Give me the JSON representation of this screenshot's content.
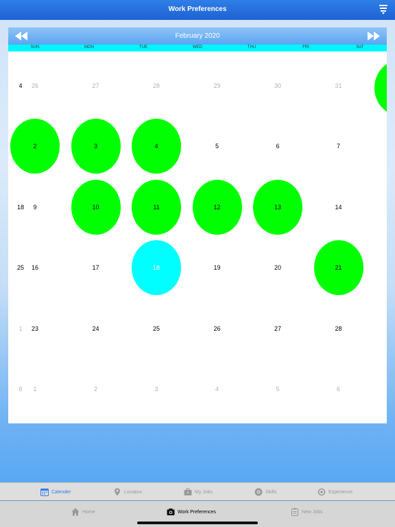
{
  "nav": {
    "title": "Work Preferences",
    "menu_icon": "filter-list-icon"
  },
  "calendar": {
    "month_title": "February 2020",
    "prev_icon": "double-left-arrow-icon",
    "next_icon": "double-right-arrow-icon",
    "weekdays": [
      "SUN",
      "MON",
      "TUE",
      "WED",
      "THU",
      "FRI",
      "SAT"
    ],
    "week_numbers": [
      {
        "text": "4",
        "muted": false
      },
      {
        "text": "",
        "muted": false
      },
      {
        "text": "18",
        "muted": false
      },
      {
        "text": "25",
        "muted": false
      },
      {
        "text": "1",
        "muted": true
      },
      {
        "text": "8",
        "muted": true
      }
    ],
    "weeks": [
      [
        {
          "text": "26",
          "muted": true,
          "state": ""
        },
        {
          "text": "27",
          "muted": true,
          "state": ""
        },
        {
          "text": "28",
          "muted": true,
          "state": ""
        },
        {
          "text": "29",
          "muted": true,
          "state": ""
        },
        {
          "text": "30",
          "muted": true,
          "state": ""
        },
        {
          "text": "31",
          "muted": true,
          "state": ""
        },
        {
          "text": "",
          "muted": false,
          "state": ""
        }
      ],
      [
        {
          "text": "2",
          "muted": false,
          "state": "selected"
        },
        {
          "text": "3",
          "muted": false,
          "state": "selected"
        },
        {
          "text": "4",
          "muted": false,
          "state": "selected"
        },
        {
          "text": "5",
          "muted": false,
          "state": ""
        },
        {
          "text": "6",
          "muted": false,
          "state": ""
        },
        {
          "text": "7",
          "muted": false,
          "state": ""
        },
        {
          "text": "",
          "muted": false,
          "state": ""
        }
      ],
      [
        {
          "text": "9",
          "muted": false,
          "state": ""
        },
        {
          "text": "10",
          "muted": false,
          "state": "selected"
        },
        {
          "text": "11",
          "muted": false,
          "state": "selected"
        },
        {
          "text": "12",
          "muted": false,
          "state": "selected"
        },
        {
          "text": "13",
          "muted": false,
          "state": "selected"
        },
        {
          "text": "14",
          "muted": false,
          "state": ""
        },
        {
          "text": "",
          "muted": false,
          "state": ""
        }
      ],
      [
        {
          "text": "16",
          "muted": false,
          "state": ""
        },
        {
          "text": "17",
          "muted": false,
          "state": ""
        },
        {
          "text": "18",
          "muted": false,
          "state": "today"
        },
        {
          "text": "19",
          "muted": false,
          "state": ""
        },
        {
          "text": "20",
          "muted": false,
          "state": ""
        },
        {
          "text": "21",
          "muted": false,
          "state": "selected"
        },
        {
          "text": "",
          "muted": false,
          "state": ""
        }
      ],
      [
        {
          "text": "23",
          "muted": false,
          "state": ""
        },
        {
          "text": "24",
          "muted": false,
          "state": ""
        },
        {
          "text": "25",
          "muted": false,
          "state": ""
        },
        {
          "text": "26",
          "muted": false,
          "state": ""
        },
        {
          "text": "27",
          "muted": false,
          "state": ""
        },
        {
          "text": "28",
          "muted": false,
          "state": ""
        },
        {
          "text": "",
          "muted": false,
          "state": ""
        }
      ],
      [
        {
          "text": "1",
          "muted": true,
          "state": ""
        },
        {
          "text": "2",
          "muted": true,
          "state": ""
        },
        {
          "text": "3",
          "muted": true,
          "state": ""
        },
        {
          "text": "4",
          "muted": true,
          "state": ""
        },
        {
          "text": "5",
          "muted": true,
          "state": ""
        },
        {
          "text": "6",
          "muted": true,
          "state": ""
        },
        {
          "text": "",
          "muted": false,
          "state": ""
        }
      ]
    ]
  },
  "top_tabs": [
    {
      "label": "Calender",
      "icon": "calendar-icon",
      "active": true
    },
    {
      "label": "Location",
      "icon": "location-pin-icon",
      "active": false
    },
    {
      "label": "My Jobs",
      "icon": "briefcase-icon",
      "active": false
    },
    {
      "label": "Skills",
      "icon": "skills-badge-icon",
      "active": false
    },
    {
      "label": "Experience",
      "icon": "experience-cycle-icon",
      "active": false
    }
  ],
  "bottom_tabs": [
    {
      "label": "Home",
      "icon": "home-icon",
      "active": false
    },
    {
      "label": "Work Preferences",
      "icon": "camera-icon",
      "active": true
    },
    {
      "label": "New Jobs",
      "icon": "clipboard-icon",
      "active": false
    }
  ],
  "colors": {
    "selected": "#00ff00",
    "today": "#00ffff",
    "weekday_bar": "#00f5ff",
    "nav": "#1e62d3",
    "active_tab": "#2f7fe6"
  }
}
